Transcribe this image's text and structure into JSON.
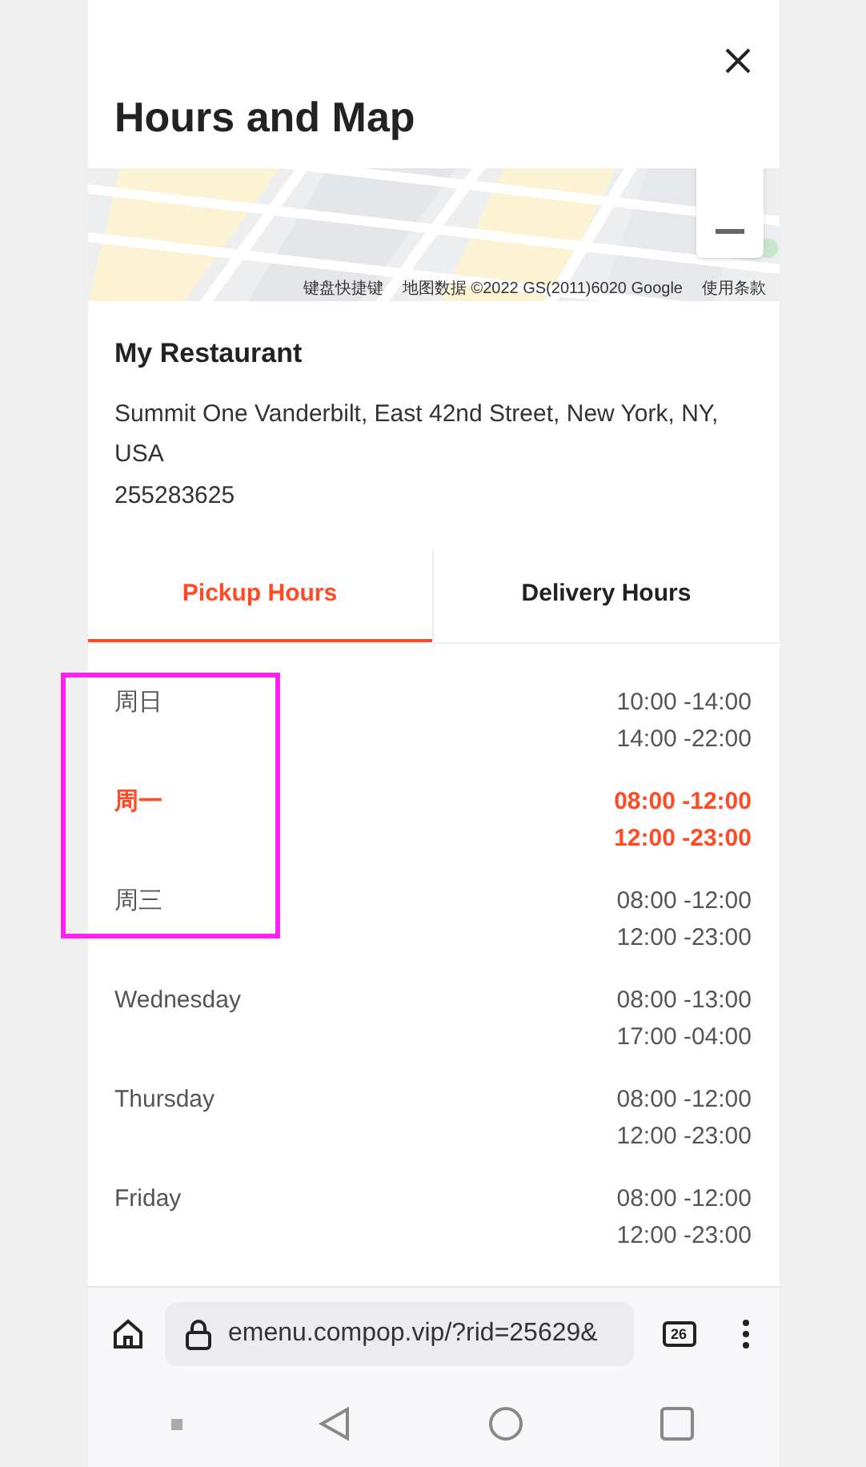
{
  "dialog": {
    "title": "Hours and Map"
  },
  "map": {
    "attribution": [
      "键盘快捷键",
      "地图数据 ©2022 GS(2011)6020 Google",
      "使用条款"
    ]
  },
  "restaurant": {
    "name": "My Restaurant",
    "address": "Summit One Vanderbilt, East 42nd Street, New York, NY, USA",
    "phone": "255283625"
  },
  "tabs": [
    {
      "label": "Pickup Hours",
      "selected": true
    },
    {
      "label": "Delivery Hours",
      "selected": false
    }
  ],
  "hours": [
    {
      "day": "周日",
      "times": [
        "10:00 -14:00",
        "14:00 -22:00"
      ],
      "selected": false
    },
    {
      "day": "周一",
      "times": [
        "08:00 -12:00",
        "12:00 -23:00"
      ],
      "selected": true
    },
    {
      "day": "周三",
      "times": [
        "08:00 -12:00",
        "12:00 -23:00"
      ],
      "selected": false
    },
    {
      "day": "Wednesday",
      "times": [
        "08:00 -13:00",
        "17:00 -04:00"
      ],
      "selected": false
    },
    {
      "day": "Thursday",
      "times": [
        "08:00 -12:00",
        "12:00 -23:00"
      ],
      "selected": false
    },
    {
      "day": "Friday",
      "times": [
        "08:00 -12:00",
        "12:00 -23:00"
      ],
      "selected": false
    }
  ],
  "highlight": {
    "color": "#ff22ee"
  },
  "browser": {
    "url": "emenu.compop.vip/?rid=25629&",
    "tab_count": "26"
  }
}
